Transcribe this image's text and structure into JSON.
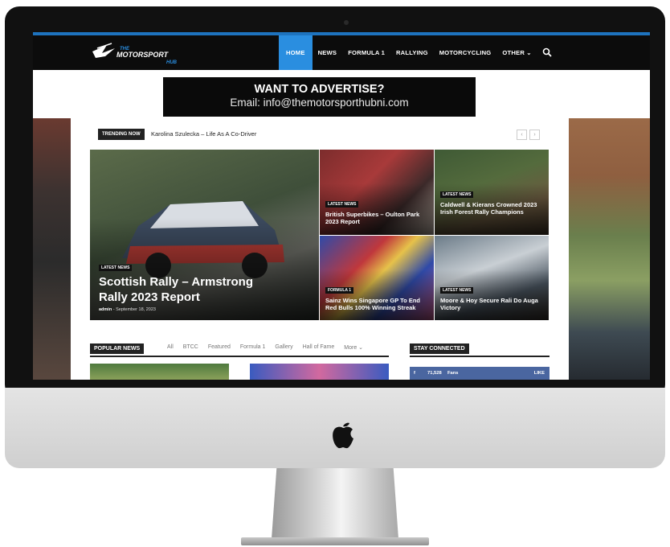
{
  "site": {
    "logo_text_top": "THE",
    "logo_text_main": "MOTORSPORT",
    "logo_text_sub": "HUB"
  },
  "nav": {
    "items": [
      {
        "label": "HOME",
        "active": true
      },
      {
        "label": "NEWS"
      },
      {
        "label": "FORMULA 1"
      },
      {
        "label": "RALLYING"
      },
      {
        "label": "MOTORCYCLING"
      },
      {
        "label": "OTHER ⌄"
      }
    ],
    "search_icon": "search-icon"
  },
  "ad": {
    "title": "WANT TO ADVERTISE?",
    "email": "Email: info@themotorsporthubni.com"
  },
  "trending": {
    "label": "TRENDING NOW",
    "headline": "Karolina Szulecka – Life As A Co-Driver",
    "prev": "‹",
    "next": "›"
  },
  "featured": {
    "main": {
      "badge": "LATEST NEWS",
      "title": "Scottish Rally – Armstrong Rally 2023 Report",
      "author": "admin",
      "date": "- September 18, 2023"
    },
    "tiles": [
      {
        "badge": "LATEST NEWS",
        "title": "British Superbikes – Oulton Park 2023 Report"
      },
      {
        "badge": "LATEST NEWS",
        "title": "Caldwell & Kierans Crowned 2023 Irish Forest Rally Champions"
      },
      {
        "badge": "FORMULA 1",
        "title": "Sainz Wins Singapore GP To End Red Bulls 100% Winning Streak"
      },
      {
        "badge": "LATEST NEWS",
        "title": "Moore & Hoy Secure Rali Do Auga Victory"
      }
    ]
  },
  "popular": {
    "label": "POPULAR NEWS",
    "tabs": [
      "All",
      "BTCC",
      "Featured",
      "Formula 1",
      "Gallery",
      "Hall of Fame",
      "More ⌄"
    ]
  },
  "connected": {
    "label": "STAY CONNECTED",
    "fb_count": "71,528",
    "fb_unit": "Fans",
    "fb_action": "LIKE"
  },
  "colors": {
    "accent": "#2a8ee0",
    "nav_bg": "#0c0c0c",
    "facebook": "#4a66a0"
  }
}
